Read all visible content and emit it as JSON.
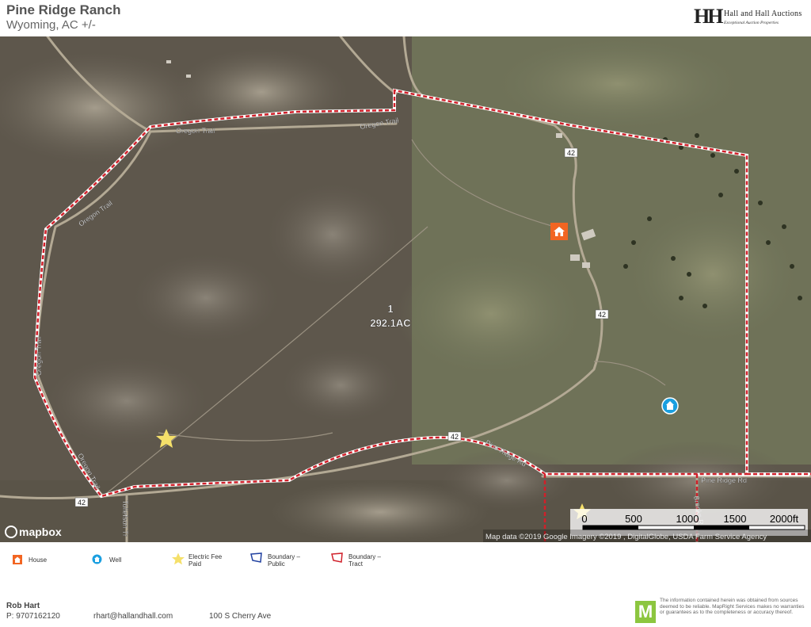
{
  "header": {
    "title": "Pine Ridge Ranch",
    "subtitle": "Wyoming,  AC +/-",
    "logo_name": "Hall and Hall",
    "logo_name_suffix": "Auctions",
    "logo_tagline": "Exceptional Auction Properties"
  },
  "map": {
    "tract_number": "1",
    "tract_acres": "292.1AC",
    "roads": {
      "oregon_trail_top": "Oregon Trail",
      "oregon_trail_top_right": "Oregon Trail",
      "oregon_trail_left_upper": "Oregon Trail",
      "oregon_trail_left": "Oregon Trail",
      "oregon_trail_bottom": "Oregon Trail",
      "pine_ridge_rd": "Pine Ridge Rd",
      "pine_ridge_rd_diag": "Pine Ridge Rd",
      "route_42_a": "42",
      "route_42_b": "42",
      "route_42_c": "42",
      "route_42_d": "42",
      "tollefson": "Tollefson Tr",
      "brooks": "Brooks Rd"
    },
    "scale": {
      "labels": [
        "0",
        "500",
        "1000",
        "1500",
        "2000ft"
      ]
    },
    "attribution": "Map data ©2019 Google  Imagery ©2019 , DigitalGlobe, USDA Farm Service Agency",
    "mapbox_logo": "mapbox",
    "colors": {
      "boundary_tract": "#d0202a",
      "boundary_public": "#2040a0",
      "house_icon": "#f26522",
      "well_icon": "#1a9fe0",
      "star": "#f5e06a"
    }
  },
  "legend": {
    "house": "House",
    "well": "Well",
    "electric_fee_line1": "Electric Fee",
    "electric_fee_line2": "Paid",
    "boundary_public_line1": "Boundary  –",
    "boundary_public_line2": "Public",
    "boundary_tract_line1": "Boundary  –",
    "boundary_tract_line2": "Tract"
  },
  "footer": {
    "agent_name": "Rob Hart",
    "phone": "P: 9707162120",
    "email": "rhart@hallandhall.com",
    "address": "100 S Cherry Ave",
    "mr_letter": "M",
    "disclaimer": "The information contained herein was obtained from sources deemed to be reliable. MapRight Services makes no warranties or guarantees as to the completeness or accuracy thereof."
  }
}
